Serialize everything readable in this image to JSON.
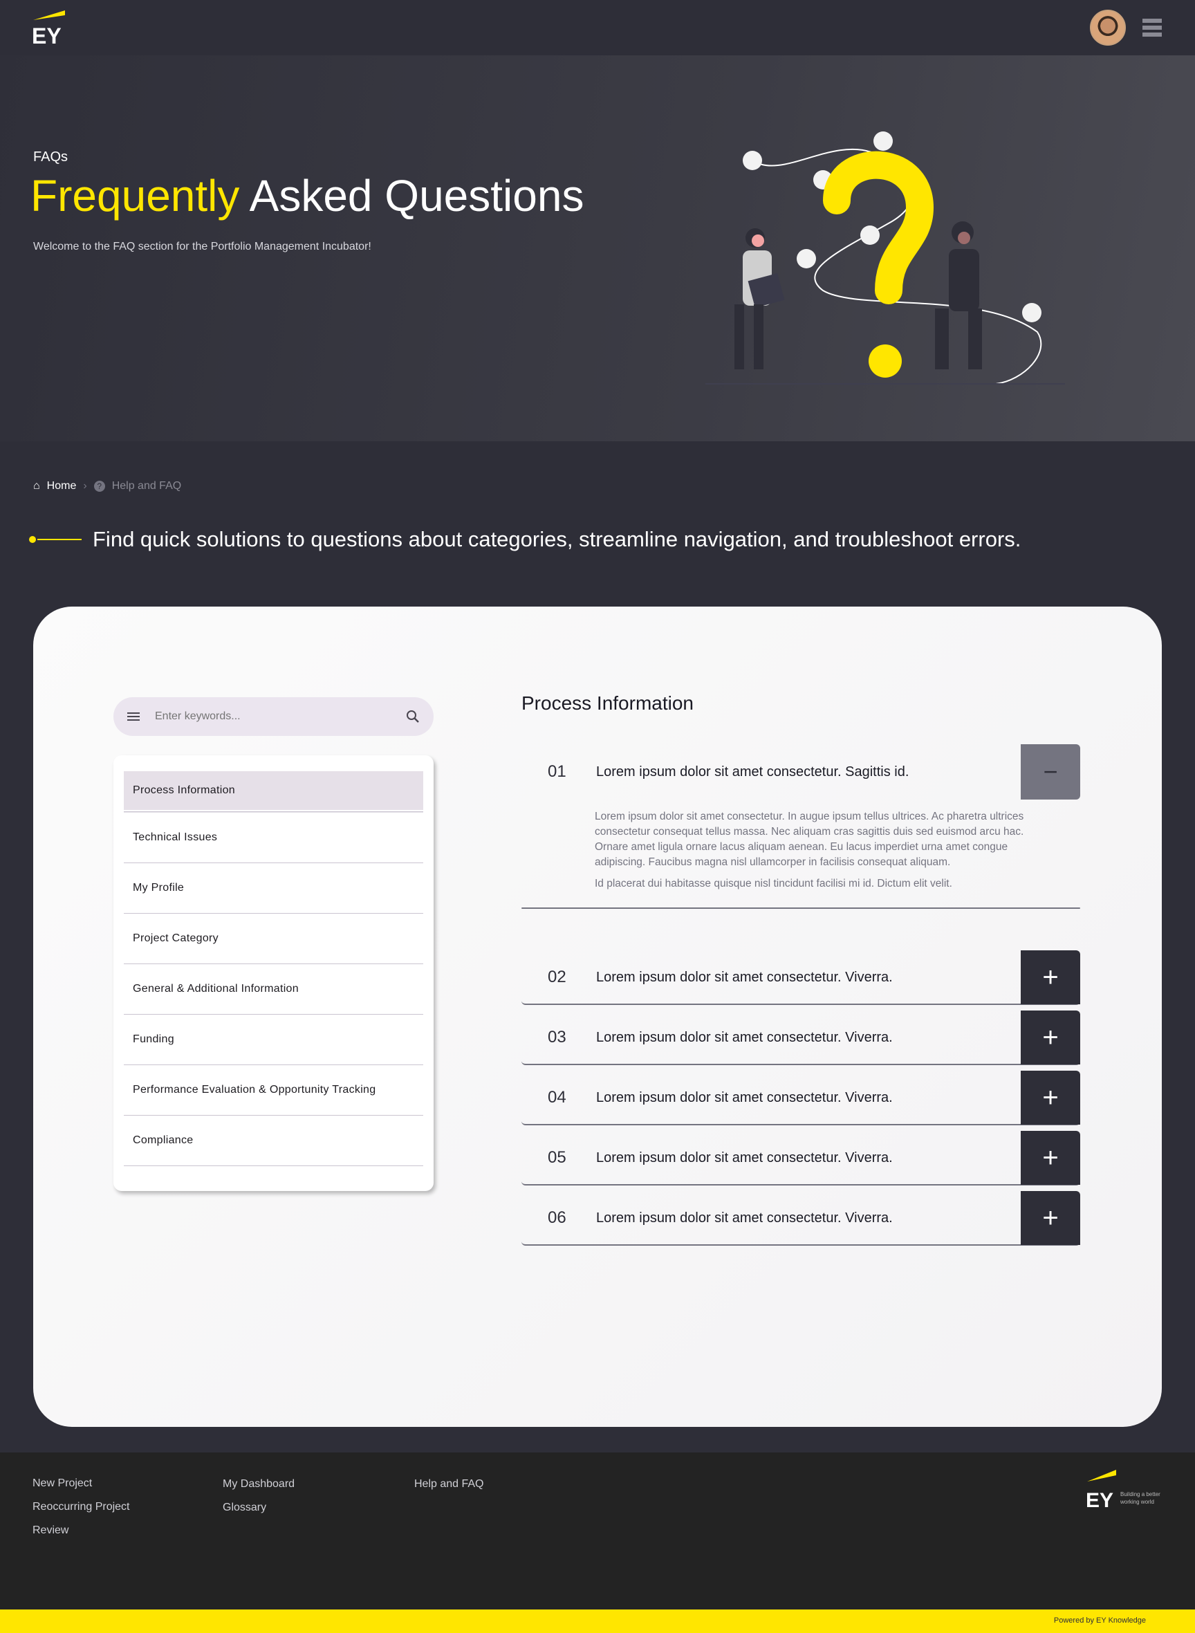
{
  "header": {
    "logo": "EY",
    "avatar_alt": "User avatar",
    "menu_icon": "hamburger-icon"
  },
  "hero": {
    "eyebrow": "FAQs",
    "title_highlight": "Frequently",
    "title_rest": "Asked Questions",
    "subtitle": "Welcome to the FAQ section for the Portfolio Management Incubator!"
  },
  "breadcrumb": {
    "home": "Home",
    "current": "Help and FAQ"
  },
  "tagline": "Find quick solutions to questions about categories, streamline navigation, and troubleshoot errors.",
  "search": {
    "placeholder": "Enter keywords..."
  },
  "categories": [
    "Process Information",
    "Technical Issues",
    "My Profile",
    "Project Category",
    "General & Additional Information",
    "Funding",
    "Performance Evaluation & Opportunity Tracking",
    "Compliance"
  ],
  "selected_category": "Process Information",
  "section_title": "Process Information",
  "faqs": [
    {
      "num": "01",
      "q": "Lorem ipsum dolor sit amet consectetur. Sagittis id.",
      "a1": "Lorem ipsum dolor sit amet consectetur. In augue ipsum tellus ultrices. Ac pharetra ultrices consectetur consequat tellus massa. Nec aliquam cras sagittis duis sed euismod arcu hac. Ornare amet ligula ornare lacus aliquam aenean. Eu lacus imperdiet urna amet congue adipiscing. Faucibus magna nisl ullamcorper in facilisis consequat aliquam.",
      "a2": "Id placerat dui habitasse quisque nisl tincidunt facilisi mi id. Dictum elit velit.",
      "btn": "−"
    },
    {
      "num": "02",
      "q": "Lorem ipsum dolor sit amet consectetur. Viverra.",
      "btn": "+"
    },
    {
      "num": "03",
      "q": "Lorem ipsum dolor sit amet consectetur. Viverra.",
      "btn": "+"
    },
    {
      "num": "04",
      "q": "Lorem ipsum dolor sit amet consectetur. Viverra.",
      "btn": "+"
    },
    {
      "num": "05",
      "q": "Lorem ipsum dolor sit amet consectetur. Viverra.",
      "btn": "+"
    },
    {
      "num": "06",
      "q": "Lorem ipsum dolor sit amet consectetur. Viverra.",
      "btn": "+"
    }
  ],
  "footer": {
    "col1": [
      "New Project",
      "Reoccurring Project",
      "Review"
    ],
    "col2": [
      "My Dashboard",
      "Glossary"
    ],
    "col3": [
      "Help and FAQ"
    ],
    "logo": "EY",
    "logo_tagline_1": "Building a better",
    "logo_tagline_2": "working world",
    "powered": "Powered by EY Knowledge"
  },
  "colors": {
    "brand_yellow": "#ffe600",
    "dark": "#2e2e38",
    "muted": "#747480"
  }
}
